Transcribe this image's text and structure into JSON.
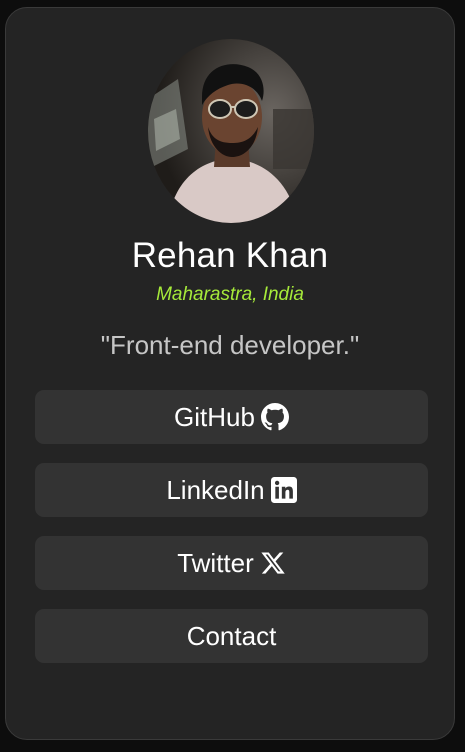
{
  "profile": {
    "name": "Rehan Khan",
    "location": "Maharastra, India",
    "bio": "\"Front-end developer.\""
  },
  "links": [
    {
      "label": "GitHub",
      "icon": "github-icon"
    },
    {
      "label": "LinkedIn",
      "icon": "linkedin-icon"
    },
    {
      "label": "Twitter",
      "icon": "x-twitter-icon"
    },
    {
      "label": "Contact",
      "icon": ""
    }
  ],
  "colors": {
    "background": "#0d0d0d",
    "card": "#242424",
    "button": "#333333",
    "accent": "#a6ea3a",
    "text": "#ffffff",
    "muted": "#c6c6c6"
  }
}
